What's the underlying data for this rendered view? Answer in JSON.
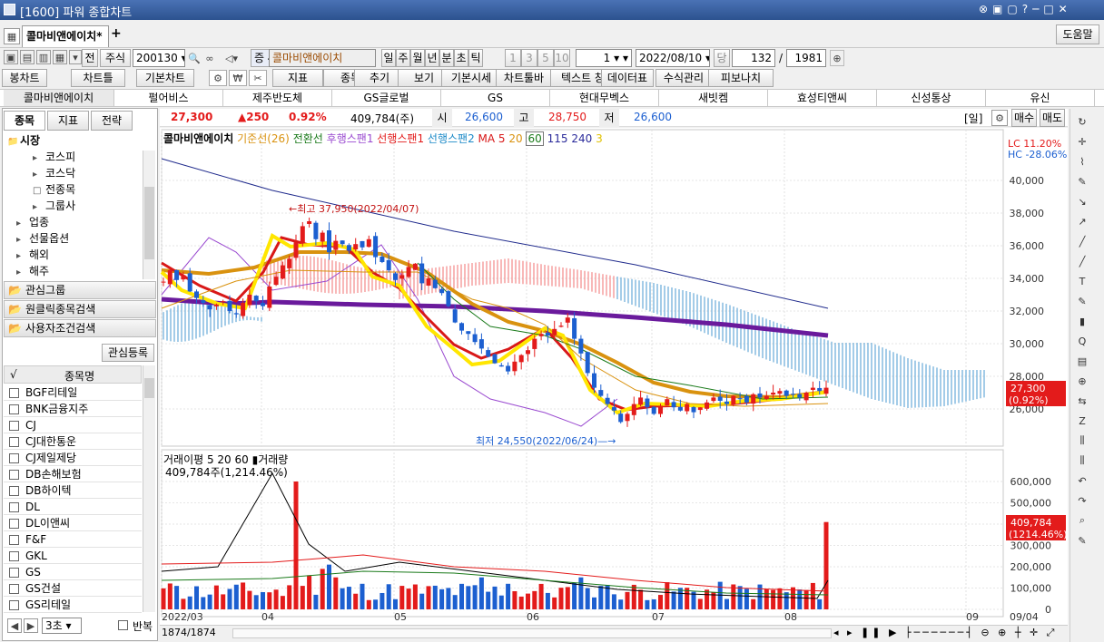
{
  "title": "[1600] 파워 종합차트",
  "tab": "콜마비앤에이치",
  "help": "도움말",
  "tb": {
    "jeon": "전",
    "jusik": "주식",
    "code": "200130",
    "name": "콜마비앤에이치",
    "jung": "증 40",
    "periods": [
      "일",
      "주",
      "월",
      "년",
      "분",
      "초",
      "틱"
    ],
    "nums": [
      "1",
      "3",
      "5",
      "10"
    ],
    "cnt": "1",
    "date": "2022/08/10",
    "dang": "당",
    "count": "132",
    "sep": "/",
    "total": "1981"
  },
  "tb2": [
    "봉차트",
    "차트틀",
    "기본차트",
    "지표",
    "종목",
    "추기",
    "보기",
    "기본시세",
    "차트툴바",
    "텍스트 창",
    "데이터표",
    "수식관리",
    "피보나치"
  ],
  "stocks": [
    "콜마비앤에이치",
    "펄어비스",
    "제주반도체",
    "GS글로벌",
    "GS",
    "현대무벡스",
    "새빗켐",
    "효성티앤씨",
    "신성통상",
    "유신"
  ],
  "left": {
    "tabs": [
      "종목",
      "지표",
      "전략"
    ],
    "tree": [
      "시장",
      "코스피",
      "코스닥",
      "전종목",
      "그룹사",
      "업종",
      "선물옵션",
      "해외",
      "해주"
    ],
    "groups": [
      "관심그룹",
      "원클릭종목검색",
      "사용자조건검색"
    ],
    "reg": "관심등록",
    "colhead": "종목명",
    "items": [
      "BGF리테일",
      "BNK금융지주",
      "CJ",
      "CJ대한통운",
      "CJ제일제당",
      "DB손해보험",
      "DB하이텍",
      "DL",
      "DL이앤씨",
      "F&F",
      "GKL",
      "GS",
      "GS건설",
      "GS리테일"
    ],
    "unit": "3초",
    "repeat": "반복"
  },
  "quote": {
    "price": "27,300",
    "chg": "▲250",
    "pct": "0.92%",
    "vol": "409,784(주)",
    "o_lbl": "시",
    "o": "26,600",
    "h_lbl": "고",
    "h": "28,750",
    "l_lbl": "저",
    "l": "26,600",
    "mode": "[일]",
    "buy": "매수",
    "sell": "매도"
  },
  "legend": {
    "name": "콜마비앤에이치",
    "base": "기준선(26)",
    "conv": "전환선",
    "lag": "후행스팬1",
    "lead1": "선행스팬1",
    "lead2": "선행스팬2",
    "ma": "MA 5",
    "m20": "20",
    "m60": "60",
    "m115": "115",
    "m240": "240",
    "m3": "3",
    "lc": "LC  11.20%",
    "hc": "HC -28.06%"
  },
  "ann": {
    "hi": "←최고 37,950(2022/04/07)",
    "lo": "최저 24,550(2022/06/24)—→"
  },
  "colors": {
    "up": "#e31b1b",
    "down": "#1c5fd0",
    "ma5": "#ffe600",
    "ma20": "#d81818",
    "ma60": "#d9920f",
    "ma240": "#6a1a9c",
    "trend": "#1f2a8c"
  },
  "chart_data": {
    "type": "candlestick",
    "price_axis": [
      40000,
      38000,
      36000,
      34000,
      32000,
      30000,
      28000,
      26000
    ],
    "price_labels": [
      "40,000",
      "38,000",
      "36,000",
      "34,000",
      "32,000",
      "30,000",
      "28,000",
      "26,000"
    ],
    "last_price": "27,300",
    "last_pct": "(0.92%)",
    "vol_legend": "거래이평  5  20  60",
    "vol_legend2": "거래량",
    "vol_value": "409,784주(1,214.46%)",
    "vol_axis": [
      600000,
      500000,
      400000,
      300000,
      200000,
      100000,
      0
    ],
    "vol_labels": [
      "600,000",
      "500,000",
      "400,000",
      "300,000",
      "200,000",
      "100,000",
      "0"
    ],
    "vol_last": "409,784",
    "vol_last_pct": "(1214.46%)",
    "x_labels": [
      "2022/03",
      "04",
      "05",
      "06",
      "07",
      "08",
      "09"
    ],
    "x_end": "09/04",
    "scroll": "1874/1874"
  }
}
